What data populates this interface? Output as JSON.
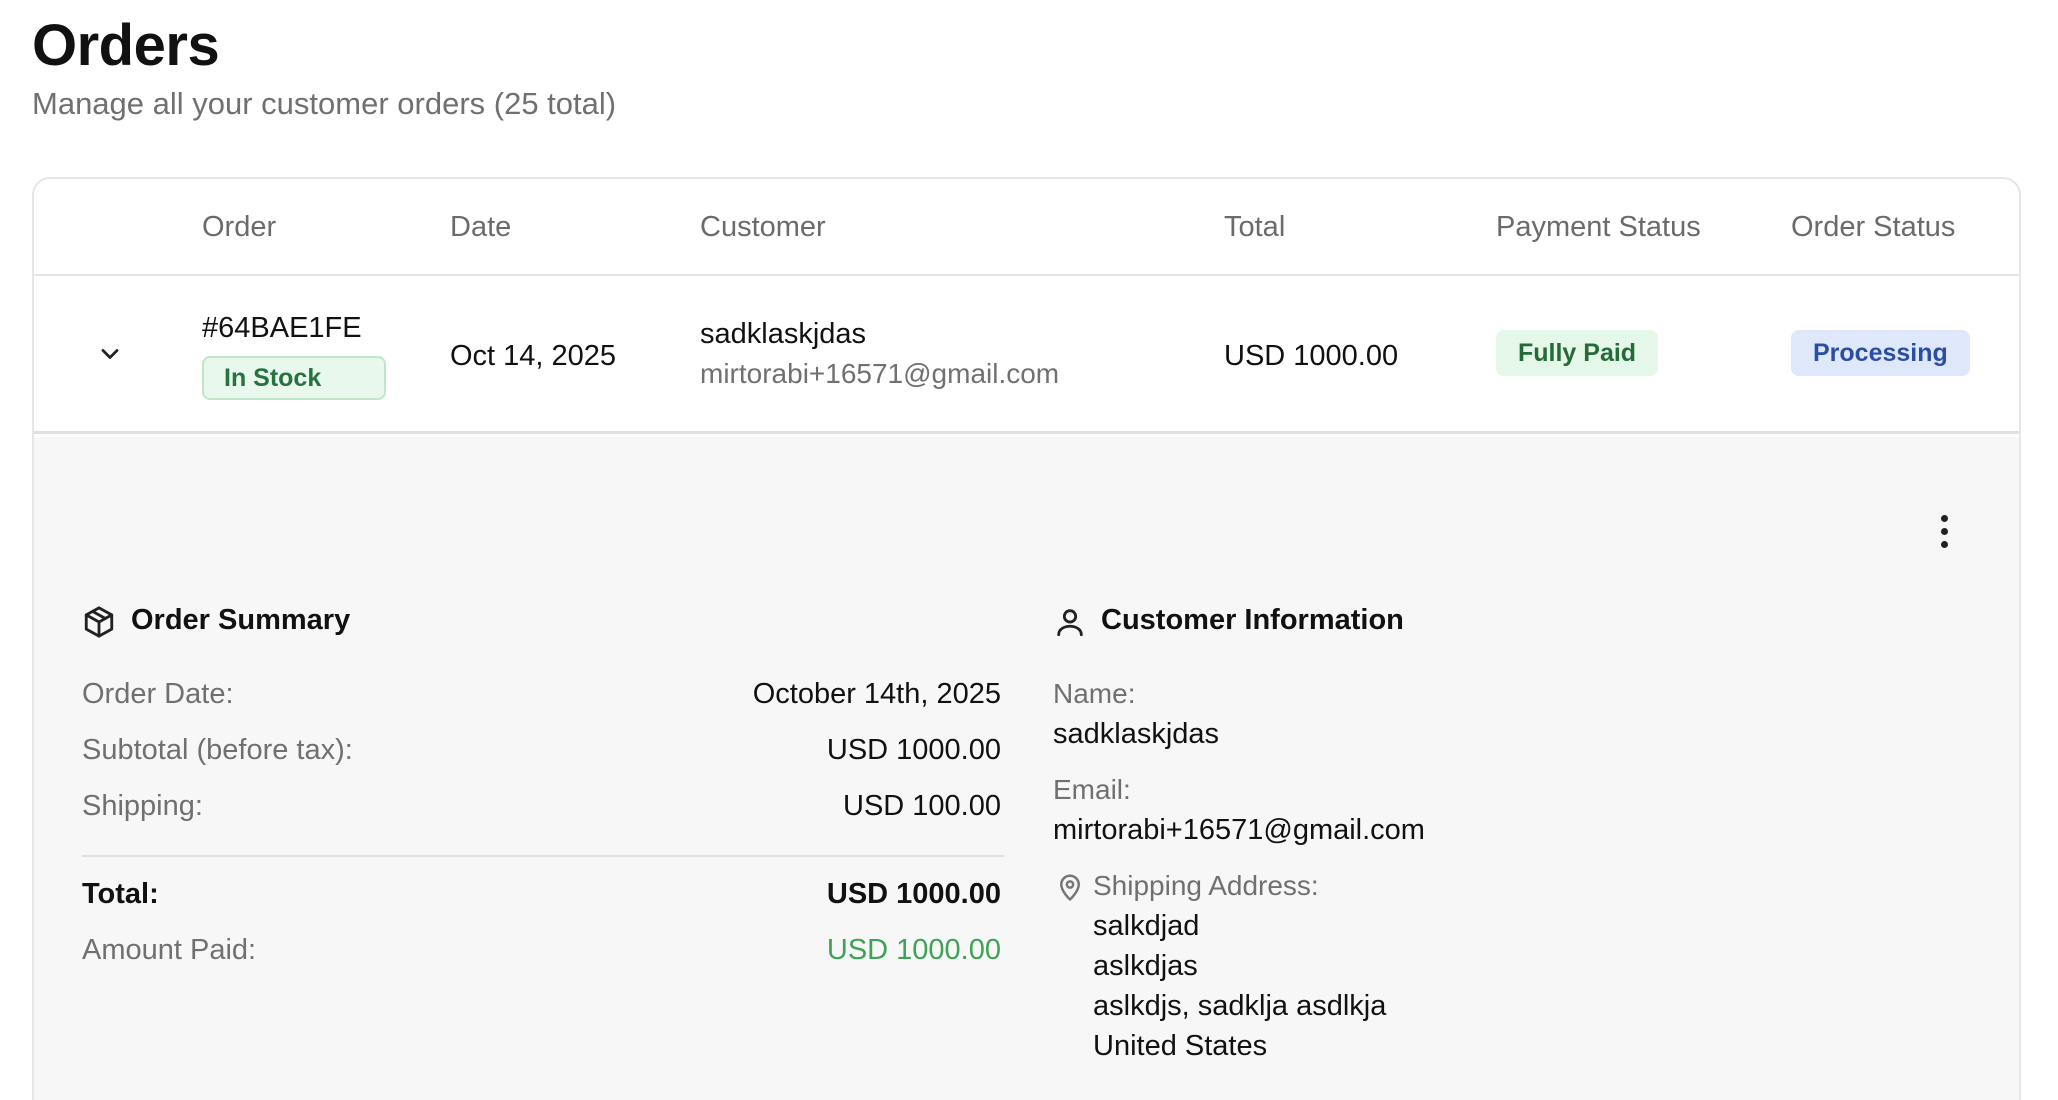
{
  "header": {
    "title": "Orders",
    "subtitle": "Manage all your customer orders (25 total)"
  },
  "table": {
    "columns": [
      "Order",
      "Date",
      "Customer",
      "Total",
      "Payment Status",
      "Order Status"
    ],
    "row": {
      "order_id": "#64BAE1FE",
      "stock_badge": "In Stock",
      "date": "Oct 14, 2025",
      "customer_name": "sadklaskjdas",
      "customer_email": "mirtorabi+16571@gmail.com",
      "total": "USD 1000.00",
      "payment_status": "Fully Paid",
      "order_status": "Processing"
    }
  },
  "details": {
    "order_summary": {
      "title": "Order Summary",
      "order_date_label": "Order Date:",
      "order_date_value": "October 14th, 2025",
      "subtotal_label": "Subtotal (before tax):",
      "subtotal_value": "USD 1000.00",
      "shipping_label": "Shipping:",
      "shipping_value": "USD 100.00",
      "total_label": "Total:",
      "total_value": "USD 1000.00",
      "amount_paid_label": "Amount Paid:",
      "amount_paid_value": "USD 1000.00"
    },
    "customer_info": {
      "title": "Customer Information",
      "name_label": "Name:",
      "name_value": "sadklaskjdas",
      "email_label": "Email:",
      "email_value": "mirtorabi+16571@gmail.com",
      "address_label": "Shipping Address:",
      "address_lines": [
        "salkdjad",
        "aslkdjas",
        "aslkdjs, sadklja asdlkja",
        "United States"
      ]
    }
  },
  "colors": {
    "paid_green": "#3ea356",
    "processing_blue": "#2a4ea5",
    "in_stock_green": "#26733f"
  },
  "icons": {
    "expand": "chevron-down-icon",
    "more": "more-vertical-icon",
    "summary": "package-icon",
    "customer": "user-icon",
    "address": "map-pin-icon"
  }
}
